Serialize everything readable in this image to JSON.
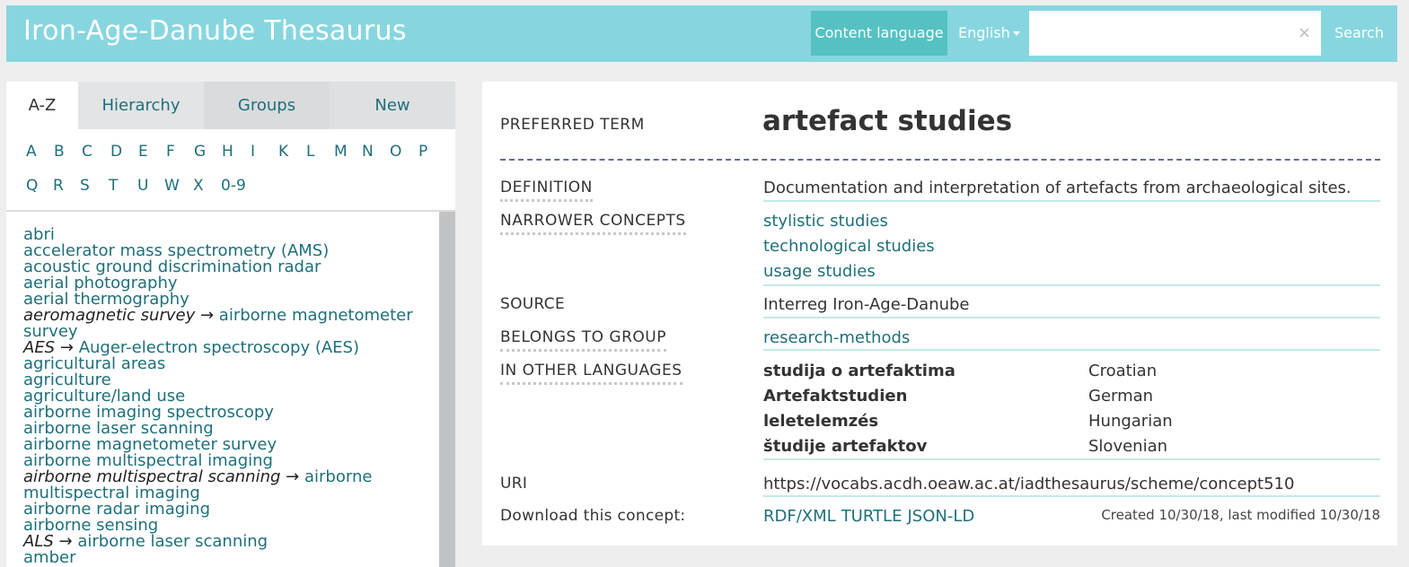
{
  "header": {
    "site_title": "Iron-Age-Danube Thesaurus",
    "content_language_label": "Content language",
    "language_selected": "English",
    "search_placeholder": "",
    "clear_symbol": "×",
    "search_label": "Search"
  },
  "sidebar": {
    "tabs": [
      "A-Z",
      "Hierarchy",
      "Groups",
      "New"
    ],
    "active_tab": "A-Z",
    "letters_row1": [
      "A",
      "B",
      "C",
      "D",
      "E",
      "F",
      "G",
      "H",
      "I",
      "K",
      "L",
      "M",
      "N",
      "O",
      "P"
    ],
    "letters_row2": [
      "Q",
      "R",
      "S",
      "T",
      "U",
      "W",
      "X",
      "0-9"
    ],
    "terms": [
      {
        "text": "abri"
      },
      {
        "text": "accelerator mass spectrometry (AMS)"
      },
      {
        "text": "acoustic ground discrimination radar"
      },
      {
        "text": "aerial photography"
      },
      {
        "text": "aerial thermography"
      },
      {
        "alt": "aeromagnetic survey",
        "arrow": "→",
        "target": "airborne magnetometer"
      },
      {
        "text": "survey"
      },
      {
        "alt": "AES",
        "arrow": "→",
        "target": "Auger-electron spectroscopy (AES)"
      },
      {
        "text": "agricultural areas"
      },
      {
        "text": "agriculture"
      },
      {
        "text": "agriculture/land use"
      },
      {
        "text": "airborne imaging spectroscopy"
      },
      {
        "text": "airborne laser scanning"
      },
      {
        "text": "airborne magnetometer survey"
      },
      {
        "text": "airborne multispectral imaging"
      },
      {
        "alt": "airborne multispectral scanning",
        "arrow": "→",
        "target": "airborne"
      },
      {
        "text": "multispectral imaging"
      },
      {
        "text": "airborne radar imaging"
      },
      {
        "text": "airborne sensing"
      },
      {
        "alt": "ALS",
        "arrow": "→",
        "target": "airborne laser scanning"
      },
      {
        "text": "amber"
      }
    ]
  },
  "concept": {
    "preferred_term_label": "PREFERRED TERM",
    "preferred_term": "artefact studies",
    "definition_label": "DEFINITION",
    "definition": "Documentation and interpretation of artefacts from archaeological sites.",
    "narrower_label": "NARROWER CONCEPTS",
    "narrower": [
      "stylistic studies",
      "technological studies",
      "usage studies"
    ],
    "source_label": "SOURCE",
    "source": "Interreg Iron-Age-Danube",
    "group_label": "BELONGS TO GROUP",
    "group": "research-methods",
    "other_languages_label": "IN OTHER LANGUAGES",
    "other_languages": [
      {
        "term": "studija o artefaktima",
        "language": "Croatian"
      },
      {
        "term": "Artefaktstudien",
        "language": "German"
      },
      {
        "term": "leletelemzés",
        "language": "Hungarian"
      },
      {
        "term": "študije artefaktov",
        "language": "Slovenian"
      }
    ],
    "uri_label": "URI",
    "uri": "https://vocabs.acdh.oeaw.ac.at/iadthesaurus/scheme/concept510",
    "download_label": "Download this concept:",
    "download_formats": [
      "RDF/XML",
      "TURTLE",
      "JSON-LD"
    ],
    "created_info": "Created 10/30/18, last modified 10/30/18"
  },
  "colors": {
    "header_bg": "#87d6df",
    "content_language_bg": "#55c1c3",
    "link": "#1e6f7a",
    "dashed_rule": "#5d6f99",
    "separator": "#c5e8ea"
  }
}
